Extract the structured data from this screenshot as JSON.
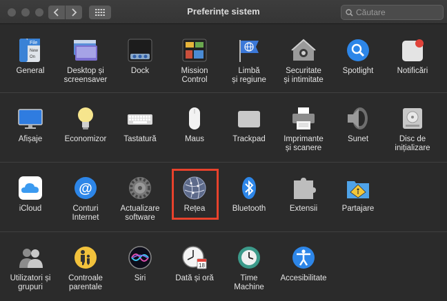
{
  "window": {
    "title": "Preferințe sistem",
    "search_placeholder": "Căutare"
  },
  "sections": [
    {
      "panes": [
        {
          "id": "general",
          "label": "General",
          "icon": "general-icon"
        },
        {
          "id": "desktop",
          "label": "Desktop și\nscreensaver",
          "icon": "desktop-screensaver-icon"
        },
        {
          "id": "dock",
          "label": "Dock",
          "icon": "dock-icon"
        },
        {
          "id": "mission-control",
          "label": "Mission\nControl",
          "icon": "mission-control-icon"
        },
        {
          "id": "language",
          "label": "Limbă\nși regiune",
          "icon": "language-flag-icon"
        },
        {
          "id": "security",
          "label": "Securitate\nși intimitate",
          "icon": "house-lock-icon"
        },
        {
          "id": "spotlight",
          "label": "Spotlight",
          "icon": "magnifier-icon"
        },
        {
          "id": "notifications",
          "label": "Notificări",
          "icon": "notifications-icon"
        }
      ]
    },
    {
      "panes": [
        {
          "id": "displays",
          "label": "Afișaje",
          "icon": "display-icon"
        },
        {
          "id": "energy",
          "label": "Economizor",
          "icon": "lightbulb-icon"
        },
        {
          "id": "keyboard",
          "label": "Tastatură",
          "icon": "keyboard-icon"
        },
        {
          "id": "mouse",
          "label": "Maus",
          "icon": "mouse-icon"
        },
        {
          "id": "trackpad",
          "label": "Trackpad",
          "icon": "trackpad-icon"
        },
        {
          "id": "printers",
          "label": "Imprimante\nși scanere",
          "icon": "printer-icon"
        },
        {
          "id": "sound",
          "label": "Sunet",
          "icon": "speaker-icon"
        },
        {
          "id": "startup-disk",
          "label": "Disc de\ninițializare",
          "icon": "disk-icon"
        }
      ]
    },
    {
      "panes": [
        {
          "id": "icloud",
          "label": "iCloud",
          "icon": "cloud-icon"
        },
        {
          "id": "internet-accounts",
          "label": "Conturi\nInternet",
          "icon": "at-sign-icon"
        },
        {
          "id": "software-update",
          "label": "Actualizare\nsoftware",
          "icon": "gear-icon"
        },
        {
          "id": "network",
          "label": "Rețea",
          "icon": "network-globe-icon"
        },
        {
          "id": "bluetooth",
          "label": "Bluetooth",
          "icon": "bluetooth-icon"
        },
        {
          "id": "extensions",
          "label": "Extensii",
          "icon": "puzzle-icon"
        },
        {
          "id": "sharing",
          "label": "Partajare",
          "icon": "sharing-folder-icon"
        }
      ]
    },
    {
      "panes": [
        {
          "id": "users",
          "label": "Utilizatori și\ngrupuri",
          "icon": "users-icon"
        },
        {
          "id": "parental",
          "label": "Controale\nparentale",
          "icon": "parental-icon"
        },
        {
          "id": "siri",
          "label": "Siri",
          "icon": "siri-icon"
        },
        {
          "id": "datetime",
          "label": "Dată și oră",
          "icon": "clock-calendar-icon"
        },
        {
          "id": "time-machine",
          "label": "Time\nMachine",
          "icon": "time-machine-icon"
        },
        {
          "id": "accessibility",
          "label": "Accesibilitate",
          "icon": "accessibility-icon"
        }
      ]
    }
  ],
  "general_icon_text": {
    "line1": "File",
    "line2": "New",
    "line3": "On"
  },
  "calendar_day": "18",
  "highlight": {
    "pane": "network",
    "color": "#e8422c"
  },
  "colors": {
    "background": "#2b2b2b",
    "titlebar": "#3a3a3a",
    "accent": "#1a8cff"
  }
}
